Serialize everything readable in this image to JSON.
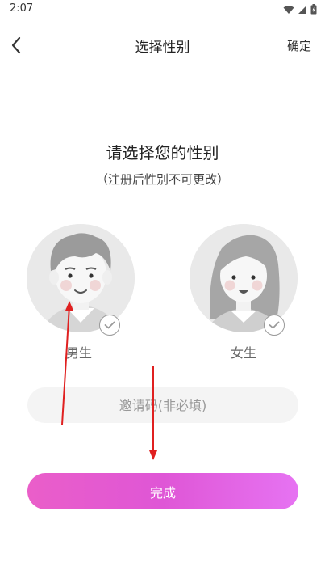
{
  "status_bar": {
    "time": "2:07"
  },
  "nav": {
    "back_icon": "chevron-left-icon",
    "title": "选择性别",
    "confirm_label": "确定"
  },
  "main": {
    "heading": "请选择您的性别",
    "subheading": "（注册后性别不可更改）",
    "genders": [
      {
        "label": "男生",
        "icon": "male-avatar",
        "selected": false
      },
      {
        "label": "女生",
        "icon": "female-avatar",
        "selected": false
      }
    ],
    "invite": {
      "placeholder": "邀请码(非必填)",
      "value": ""
    },
    "done_label": "完成"
  },
  "colors": {
    "button_gradient_start": "#ea5ec9",
    "button_gradient_end": "#e673f2",
    "annotation_arrow": "#e02020"
  }
}
